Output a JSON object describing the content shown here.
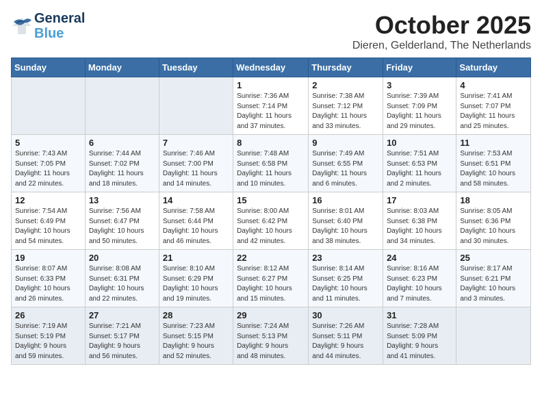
{
  "logo": {
    "line1": "General",
    "line2": "Blue"
  },
  "title": "October 2025",
  "subtitle": "Dieren, Gelderland, The Netherlands",
  "weekdays": [
    "Sunday",
    "Monday",
    "Tuesday",
    "Wednesday",
    "Thursday",
    "Friday",
    "Saturday"
  ],
  "weeks": [
    [
      {
        "day": "",
        "info": ""
      },
      {
        "day": "",
        "info": ""
      },
      {
        "day": "",
        "info": ""
      },
      {
        "day": "1",
        "info": "Sunrise: 7:36 AM\nSunset: 7:14 PM\nDaylight: 11 hours\nand 37 minutes."
      },
      {
        "day": "2",
        "info": "Sunrise: 7:38 AM\nSunset: 7:12 PM\nDaylight: 11 hours\nand 33 minutes."
      },
      {
        "day": "3",
        "info": "Sunrise: 7:39 AM\nSunset: 7:09 PM\nDaylight: 11 hours\nand 29 minutes."
      },
      {
        "day": "4",
        "info": "Sunrise: 7:41 AM\nSunset: 7:07 PM\nDaylight: 11 hours\nand 25 minutes."
      }
    ],
    [
      {
        "day": "5",
        "info": "Sunrise: 7:43 AM\nSunset: 7:05 PM\nDaylight: 11 hours\nand 22 minutes."
      },
      {
        "day": "6",
        "info": "Sunrise: 7:44 AM\nSunset: 7:02 PM\nDaylight: 11 hours\nand 18 minutes."
      },
      {
        "day": "7",
        "info": "Sunrise: 7:46 AM\nSunset: 7:00 PM\nDaylight: 11 hours\nand 14 minutes."
      },
      {
        "day": "8",
        "info": "Sunrise: 7:48 AM\nSunset: 6:58 PM\nDaylight: 11 hours\nand 10 minutes."
      },
      {
        "day": "9",
        "info": "Sunrise: 7:49 AM\nSunset: 6:55 PM\nDaylight: 11 hours\nand 6 minutes."
      },
      {
        "day": "10",
        "info": "Sunrise: 7:51 AM\nSunset: 6:53 PM\nDaylight: 11 hours\nand 2 minutes."
      },
      {
        "day": "11",
        "info": "Sunrise: 7:53 AM\nSunset: 6:51 PM\nDaylight: 10 hours\nand 58 minutes."
      }
    ],
    [
      {
        "day": "12",
        "info": "Sunrise: 7:54 AM\nSunset: 6:49 PM\nDaylight: 10 hours\nand 54 minutes."
      },
      {
        "day": "13",
        "info": "Sunrise: 7:56 AM\nSunset: 6:47 PM\nDaylight: 10 hours\nand 50 minutes."
      },
      {
        "day": "14",
        "info": "Sunrise: 7:58 AM\nSunset: 6:44 PM\nDaylight: 10 hours\nand 46 minutes."
      },
      {
        "day": "15",
        "info": "Sunrise: 8:00 AM\nSunset: 6:42 PM\nDaylight: 10 hours\nand 42 minutes."
      },
      {
        "day": "16",
        "info": "Sunrise: 8:01 AM\nSunset: 6:40 PM\nDaylight: 10 hours\nand 38 minutes."
      },
      {
        "day": "17",
        "info": "Sunrise: 8:03 AM\nSunset: 6:38 PM\nDaylight: 10 hours\nand 34 minutes."
      },
      {
        "day": "18",
        "info": "Sunrise: 8:05 AM\nSunset: 6:36 PM\nDaylight: 10 hours\nand 30 minutes."
      }
    ],
    [
      {
        "day": "19",
        "info": "Sunrise: 8:07 AM\nSunset: 6:33 PM\nDaylight: 10 hours\nand 26 minutes."
      },
      {
        "day": "20",
        "info": "Sunrise: 8:08 AM\nSunset: 6:31 PM\nDaylight: 10 hours\nand 22 minutes."
      },
      {
        "day": "21",
        "info": "Sunrise: 8:10 AM\nSunset: 6:29 PM\nDaylight: 10 hours\nand 19 minutes."
      },
      {
        "day": "22",
        "info": "Sunrise: 8:12 AM\nSunset: 6:27 PM\nDaylight: 10 hours\nand 15 minutes."
      },
      {
        "day": "23",
        "info": "Sunrise: 8:14 AM\nSunset: 6:25 PM\nDaylight: 10 hours\nand 11 minutes."
      },
      {
        "day": "24",
        "info": "Sunrise: 8:16 AM\nSunset: 6:23 PM\nDaylight: 10 hours\nand 7 minutes."
      },
      {
        "day": "25",
        "info": "Sunrise: 8:17 AM\nSunset: 6:21 PM\nDaylight: 10 hours\nand 3 minutes."
      }
    ],
    [
      {
        "day": "26",
        "info": "Sunrise: 7:19 AM\nSunset: 5:19 PM\nDaylight: 9 hours\nand 59 minutes."
      },
      {
        "day": "27",
        "info": "Sunrise: 7:21 AM\nSunset: 5:17 PM\nDaylight: 9 hours\nand 56 minutes."
      },
      {
        "day": "28",
        "info": "Sunrise: 7:23 AM\nSunset: 5:15 PM\nDaylight: 9 hours\nand 52 minutes."
      },
      {
        "day": "29",
        "info": "Sunrise: 7:24 AM\nSunset: 5:13 PM\nDaylight: 9 hours\nand 48 minutes."
      },
      {
        "day": "30",
        "info": "Sunrise: 7:26 AM\nSunset: 5:11 PM\nDaylight: 9 hours\nand 44 minutes."
      },
      {
        "day": "31",
        "info": "Sunrise: 7:28 AM\nSunset: 5:09 PM\nDaylight: 9 hours\nand 41 minutes."
      },
      {
        "day": "",
        "info": ""
      }
    ]
  ]
}
